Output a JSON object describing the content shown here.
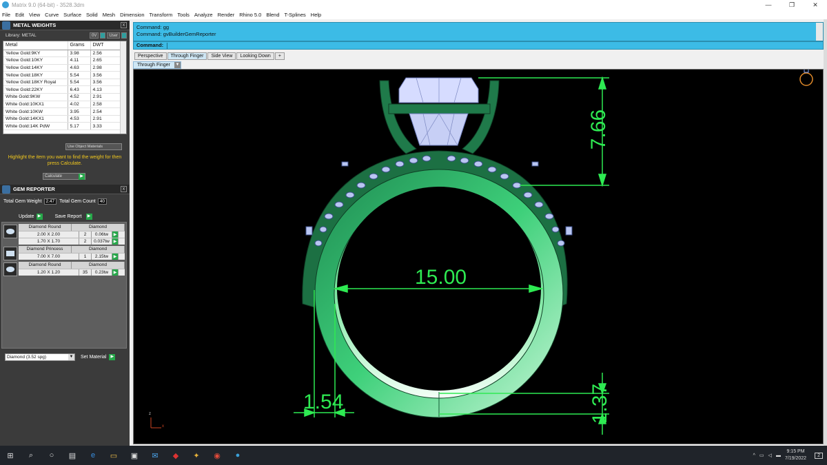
{
  "window": {
    "title": "Matrix 9.0 (64-bit) - 3528.3dm",
    "min": "—",
    "max": "❐",
    "close": "✕"
  },
  "menu": [
    "File",
    "Edit",
    "View",
    "Curve",
    "Surface",
    "Solid",
    "Mesh",
    "Dimension",
    "Transform",
    "Tools",
    "Analyze",
    "Render",
    "Rhino 5.0",
    "Blend",
    "T-Splines",
    "Help"
  ],
  "metal_weights": {
    "title": "METAL WEIGHTS",
    "library_label": "Library: METAL",
    "lib_btn_a": "0V",
    "lib_btn_b": "User",
    "columns": [
      "Metal",
      "Grams",
      "DWT"
    ],
    "rows": [
      [
        "Yellow Gold:9KY",
        "3.98",
        "2.56"
      ],
      [
        "Yellow Gold:10KY",
        "4.11",
        "2.65"
      ],
      [
        "Yellow Gold:14KY",
        "4.63",
        "2.98"
      ],
      [
        "Yellow Gold:18KY",
        "5.54",
        "3.56"
      ],
      [
        "Yellow Gold:18KY Royal",
        "5.54",
        "3.56"
      ],
      [
        "Yellow Gold:22KY",
        "6.43",
        "4.13"
      ],
      [
        "White Gold:9KW",
        "4.52",
        "2.91"
      ],
      [
        "White Gold:10KX1",
        "4.02",
        "2.58"
      ],
      [
        "White Gold:10KW",
        "3.95",
        "2.54"
      ],
      [
        "White Gold:14KX1",
        "4.53",
        "2.91"
      ],
      [
        "White Gold:14K PdW",
        "5.17",
        "3.33"
      ]
    ],
    "use_object_materials": "Use Object Materials",
    "instruction": "Highlight the item you want to find the weight for then press Calculate.",
    "calculate": "Calculate"
  },
  "gem_reporter": {
    "title": "GEM REPORTER",
    "total_weight_label": "Total Gem Weight",
    "total_weight": "2.47",
    "total_count_label": "Total Gem Count",
    "total_count": "40",
    "update": "Update",
    "save_report": "Save Report",
    "gems": [
      {
        "shape": "Diamond Round",
        "material": "Diamond",
        "sizes": [
          [
            "2.00 X 2.00",
            "2",
            "0.06tw"
          ],
          [
            "1.70 X 1.70",
            "2",
            "0.037tw"
          ]
        ]
      },
      {
        "shape": "Diamond Princess",
        "material": "Diamond",
        "sizes": [
          [
            "7.00 X 7.00",
            "1",
            "2.15tw"
          ]
        ]
      },
      {
        "shape": "Diamond Round",
        "material": "Diamond",
        "sizes": [
          [
            "1.20 X 1.20",
            "35",
            "0.23tw"
          ]
        ]
      }
    ],
    "material_select": "Diamond   (3.52 spg)",
    "set_material": "Set Material"
  },
  "command": {
    "history": [
      "Command: gg",
      "Command: gvBuilderGemReporter"
    ],
    "prompt": "Command:"
  },
  "viewport": {
    "tabs": [
      "Perspective",
      "Through Finger",
      "Side View",
      "Looking Down",
      "+"
    ],
    "active_tab": "Through Finger",
    "title": "Through Finger",
    "dims": {
      "height": "7.66",
      "inner": "15.00",
      "band_width": "1.54",
      "band_thick": "1.37"
    },
    "axis_z": "z",
    "axis_x": "x"
  },
  "taskbar": {
    "time": "9:15 PM",
    "date": "7/19/2022",
    "notif": "2"
  },
  "colors": {
    "accent": "#3cbbe6",
    "dimension": "#2eea52",
    "metal": "#1f7a4a",
    "gem": "#b9c6f2",
    "instruction": "#f2c81e"
  }
}
